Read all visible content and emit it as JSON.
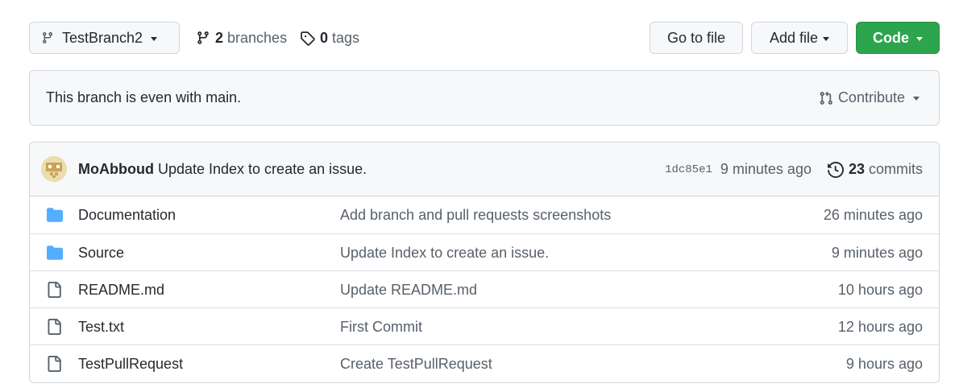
{
  "toolbar": {
    "branch_name": "TestBranch2",
    "branches_count": "2",
    "branches_label": "branches",
    "tags_count": "0",
    "tags_label": "tags",
    "go_to_file_label": "Go to file",
    "add_file_label": "Add file",
    "code_label": "Code"
  },
  "branch_status": {
    "message": "This branch is even with main.",
    "contribute_label": "Contribute"
  },
  "latest_commit": {
    "author": "MoAbboud",
    "message": "Update Index to create an issue.",
    "sha": "1dc85e1",
    "age": "9 minutes ago",
    "commits_count": "23",
    "commits_label": "commits"
  },
  "files": [
    {
      "type": "folder",
      "icon": "folder-icon",
      "name": "Documentation",
      "commit_message": "Add branch and pull requests screenshots",
      "age": "26 minutes ago"
    },
    {
      "type": "folder",
      "icon": "folder-icon",
      "name": "Source",
      "commit_message": "Update Index to create an issue.",
      "age": "9 minutes ago"
    },
    {
      "type": "file",
      "icon": "file-icon",
      "name": "README.md",
      "commit_message": "Update README.md",
      "age": "10 hours ago"
    },
    {
      "type": "file",
      "icon": "file-icon",
      "name": "Test.txt",
      "commit_message": "First Commit",
      "age": "12 hours ago"
    },
    {
      "type": "file",
      "icon": "file-icon",
      "name": "TestPullRequest",
      "commit_message": "Create TestPullRequest",
      "age": "9 hours ago"
    }
  ],
  "colors": {
    "code_button": "#2da44e",
    "folder_icon": "#54aeff",
    "border": "#d0d7de",
    "muted_text": "#57606a"
  }
}
